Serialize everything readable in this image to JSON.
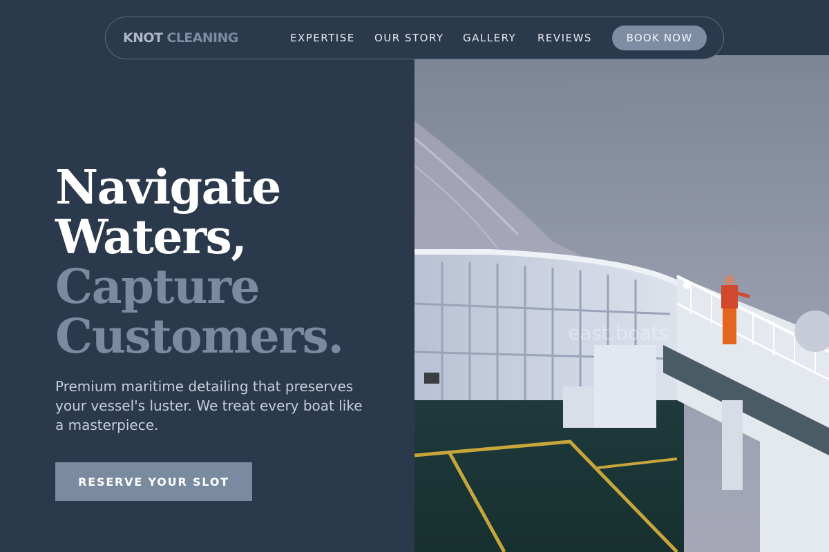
{
  "brand": {
    "logo_part1": "KNOT",
    "logo_part2": "CLEANING"
  },
  "nav": {
    "items": [
      {
        "label": "EXPERTISE"
      },
      {
        "label": "OUR STORY"
      },
      {
        "label": "GALLERY"
      },
      {
        "label": "REVIEWS"
      }
    ],
    "cta_label": "BOOK NOW"
  },
  "hero": {
    "headline_line1": "Navigate",
    "headline_line2": "Waters,",
    "headline_line3": "Capture",
    "headline_line4": "Customers.",
    "subtitle": "Premium maritime detailing that preserves your vessel's luster. We treat every boat like a masterpiece.",
    "cta_label": "RESERVE YOUR SLOT"
  },
  "image": {
    "watermark": "east.boats"
  },
  "colors": {
    "background": "#2b394c",
    "accent": "#7b8b9f",
    "text_primary": "#ffffff",
    "text_muted": "#c6cfda"
  }
}
